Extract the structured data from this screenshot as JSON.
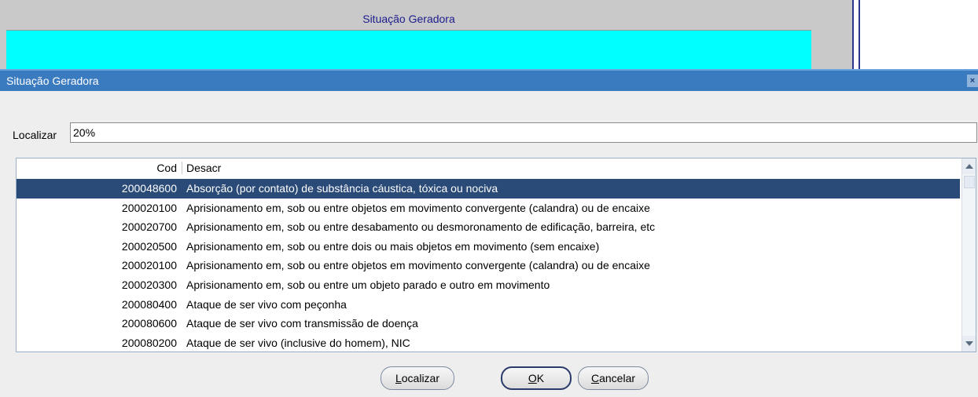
{
  "background_form": {
    "title": "Situação Geradora"
  },
  "dialog": {
    "title": "Situação Geradora",
    "close_label": "×"
  },
  "search": {
    "label": "Localizar",
    "value": "20%"
  },
  "list": {
    "columns": [
      "Cod",
      "Desacr"
    ],
    "rows": [
      {
        "cod": "200048600",
        "desc": "Absorção (por contato) de substância cáustica, tóxica ou nociva"
      },
      {
        "cod": "200020100",
        "desc": "Aprisionamento em, sob ou entre  objetos em movimento convergente (calandra) ou de encaixe"
      },
      {
        "cod": "200020700",
        "desc": "Aprisionamento em, sob ou entre desabamento ou desmoronamento de edificação, barreira, etc"
      },
      {
        "cod": "200020500",
        "desc": "Aprisionamento em, sob ou entre dois ou mais objetos em movimento (sem encaixe)"
      },
      {
        "cod": "200020100",
        "desc": "Aprisionamento em, sob ou entre objetos em movimento convergente (calandra) ou de encaixe"
      },
      {
        "cod": "200020300",
        "desc": "Aprisionamento em, sob ou entre um objeto parado e outro em movimento"
      },
      {
        "cod": "200080400",
        "desc": "Ataque de ser vivo com peçonha"
      },
      {
        "cod": "200080600",
        "desc": "Ataque de ser vivo com transmissão de doença"
      },
      {
        "cod": "200080200",
        "desc": "Ataque de ser vivo (inclusive do homem), NIC"
      }
    ],
    "selected_index": 0
  },
  "buttons": {
    "localizar": {
      "mnemonic": "L",
      "rest": "ocalizar"
    },
    "ok": {
      "mnemonic": "O",
      "rest": "K"
    },
    "cancelar": {
      "mnemonic": "C",
      "rest": "ancelar"
    }
  },
  "colors": {
    "titlebar": "#3a7bc0",
    "selection": "#2a4a78",
    "cyan_field": "#00ffff"
  }
}
